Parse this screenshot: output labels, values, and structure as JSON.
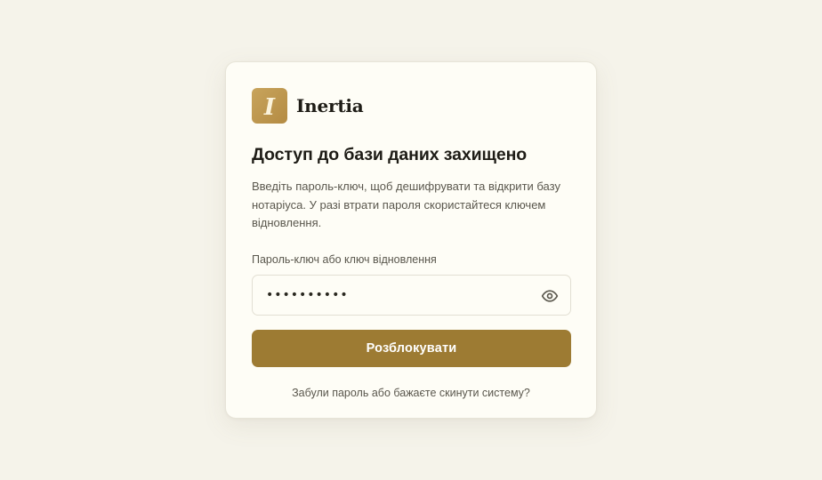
{
  "brand": {
    "logo_letter": "I",
    "name": "Inertia"
  },
  "heading": "Доступ до бази даних захищено",
  "description": "Введіть пароль-ключ, щоб дешифрувати та відкрити базу нотаріуса. У разі втрати пароля скористайтеся ключем відновлення.",
  "password_field": {
    "label": "Пароль-ключ або ключ відновлення",
    "value": "••••••••••",
    "toggle_icon": "eye-icon"
  },
  "unlock_button_label": "Розблокувати",
  "reset_link_text": "Забули пароль або бажаєте скинути систему?",
  "colors": {
    "page_background": "#f5f3ea",
    "card_background": "#fefdf6",
    "accent": "#9d7b33",
    "logo": "#c8a45c",
    "text_primary": "#1e1c16",
    "text_secondary": "#5a574d"
  }
}
